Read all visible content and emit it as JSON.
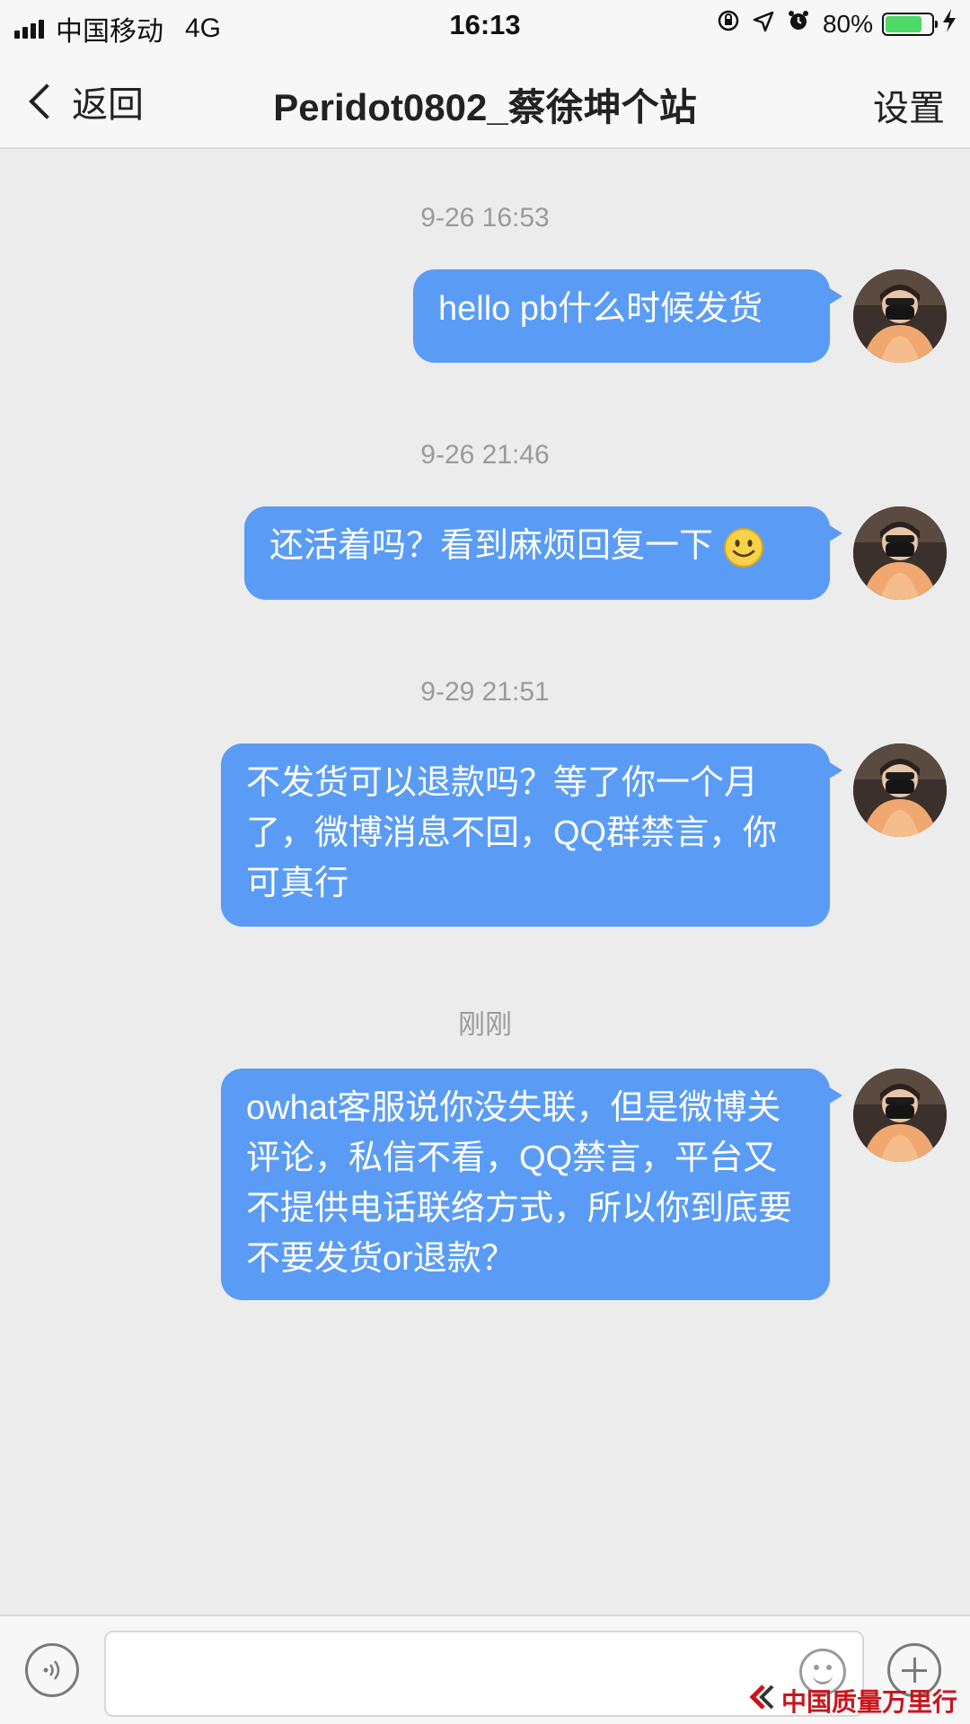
{
  "status_bar": {
    "carrier": "中国移动",
    "network": "4G",
    "time": "16:13",
    "battery_percent": "80%",
    "battery_level": 0.8,
    "colors": {
      "battery": "#4cd964"
    }
  },
  "nav": {
    "back_label": "返回",
    "title": "Peridot0802_蔡徐坤个站",
    "settings_label": "设置"
  },
  "messages": [
    {
      "time": "9-26 16:53",
      "text": "hello pb什么时候发货"
    },
    {
      "time": "9-26 21:46",
      "text": "还活着吗？看到麻烦回复一下",
      "emoji": "smiley-face"
    },
    {
      "time": "9-29 21:51",
      "text": "不发货可以退款吗？等了你一个月了，微博消息不回，QQ群禁言，你可真行"
    },
    {
      "time": "刚刚",
      "text": "owhat客服说你没失联，但是微博关评论，私信不看，QQ禁言，平台又不提供电话联络方式，所以你到底要不要发货or退款？"
    }
  ],
  "composer": {
    "input_value": "",
    "icons": [
      "voice-icon",
      "emoji-icon",
      "plus-icon"
    ]
  },
  "watermark": "中国质量万里行",
  "colors": {
    "bubble": "#5a9cf5",
    "background": "#ececec",
    "watermark": "#c8161d"
  }
}
